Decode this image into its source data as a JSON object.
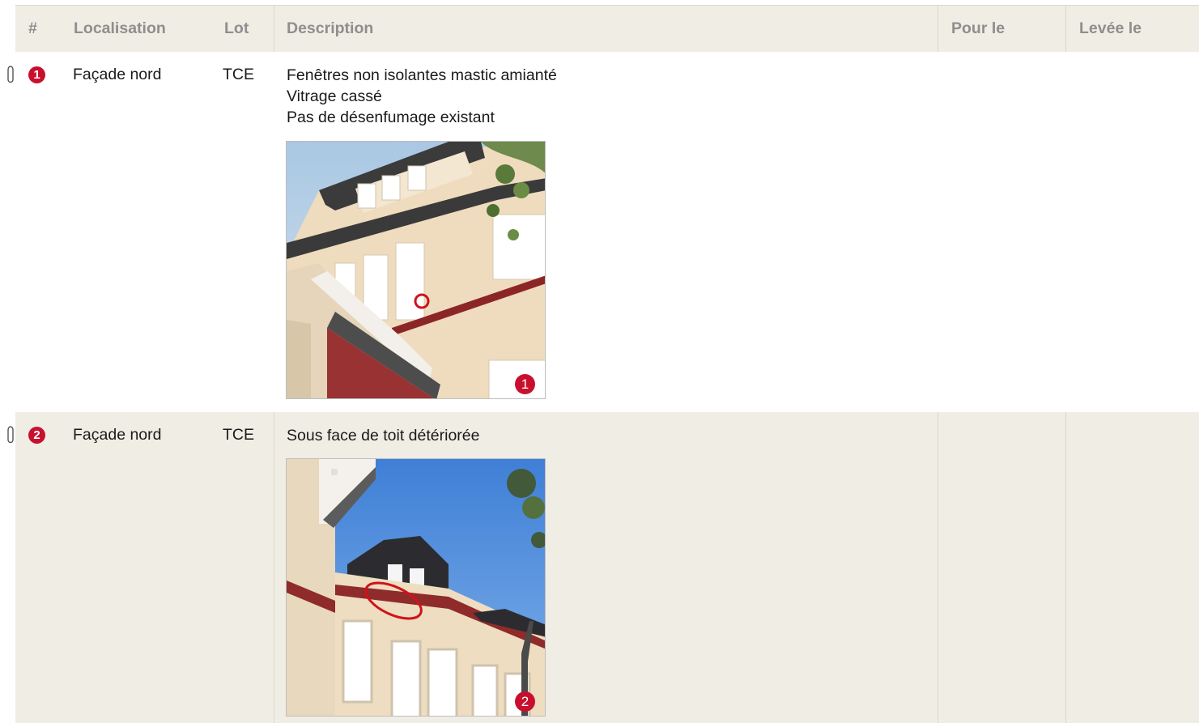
{
  "table": {
    "headers": {
      "number": "#",
      "location": "Localisation",
      "lot": "Lot",
      "description": "Description",
      "due": "Pour le",
      "lifted": "Levée le"
    }
  },
  "rows": [
    {
      "number": "1",
      "location": "Façade nord",
      "lot": "TCE",
      "description": [
        "Fenêtres non isolantes mastic amianté",
        "Vitrage cassé",
        "Pas de désenfumage existant"
      ],
      "due": "",
      "lifted": "",
      "photo_badge": "1",
      "has_attachment_icon": "paperclip-icon"
    },
    {
      "number": "2",
      "location": "Façade nord",
      "lot": "TCE",
      "description": [
        "Sous face de toit détériorée"
      ],
      "due": "",
      "lifted": "",
      "photo_badge": "2",
      "has_attachment_icon": "paperclip-icon"
    }
  ],
  "colors": {
    "header_bg": "#f0ede5",
    "header_text": "#8e8e8e",
    "badge_red": "#c8102e",
    "alt_row_bg": "#f0ede5"
  }
}
